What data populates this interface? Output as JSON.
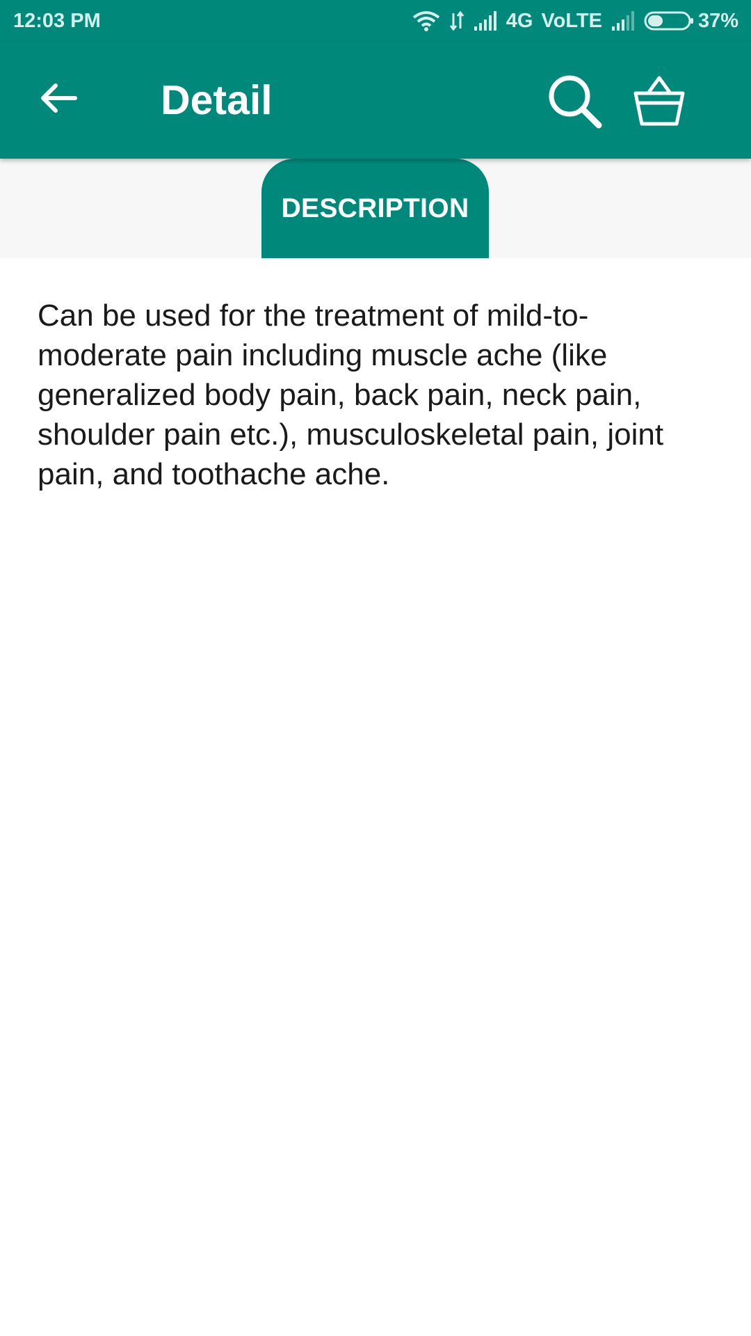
{
  "status_bar": {
    "time": "12:03 PM",
    "network": "4G",
    "volte": "VoLTE",
    "battery": "37%",
    "battery_level": 0.37,
    "icons": [
      "wifi-icon",
      "data-arrows-icon",
      "signal-icon",
      "signal-icon",
      "battery-icon"
    ]
  },
  "app_bar": {
    "title": "Detail",
    "icons": [
      "arrow-left-icon",
      "search-icon",
      "basket-icon"
    ]
  },
  "tabs": [
    {
      "label": "DESCRIPTION",
      "selected": true
    }
  ],
  "description": {
    "text": "Can be used for the treatment of mild-to-moderate pain including muscle ache (like generalized body pain, back pain, neck pain, shoulder pain etc.), musculoskeletal pain, joint pain, and toothache ache."
  },
  "colors": {
    "primary": "#00897b",
    "text": "#1a1a1a",
    "tab_strip": "#f7f7f7"
  }
}
